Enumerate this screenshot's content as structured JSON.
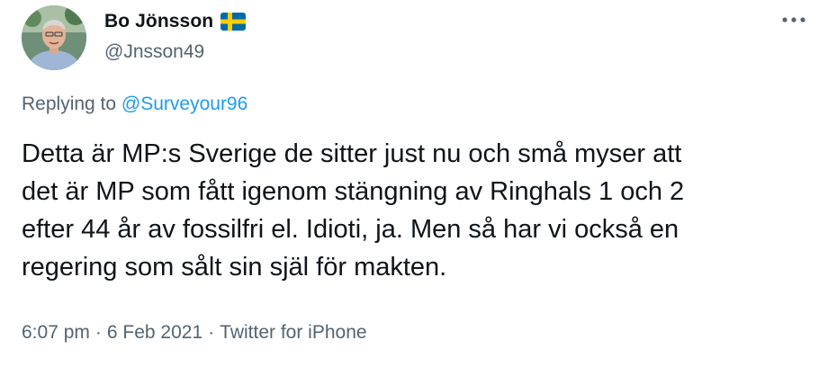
{
  "author": {
    "display_name": "Bo Jönsson",
    "handle": "@Jnsson49",
    "avatar_icon": "profile-photo",
    "flag_icon": "sweden-flag-emoji"
  },
  "more_icon": "more-horizontal-icon",
  "reply_context": {
    "prefix": "Replying to",
    "mention": "@Surveyour96"
  },
  "tweet": {
    "text_lines": [
      "Detta är MP:s Sverige de sitter just nu och små myser att",
      "det är MP som fått igenom stängning av Ringhals 1 och 2",
      "efter 44 år av fossilfri el. Idioti, ja. Men så har vi också en",
      "regering som sålt sin själ för makten."
    ]
  },
  "meta": {
    "time": "6:07 pm",
    "separator": "·",
    "date": "6 Feb 2021",
    "source": "Twitter for iPhone"
  },
  "colors": {
    "text": "#0f1419",
    "secondary": "#536471",
    "link": "#1d9bf0",
    "flag_blue": "#006aa7",
    "flag_yellow": "#fecc00"
  }
}
